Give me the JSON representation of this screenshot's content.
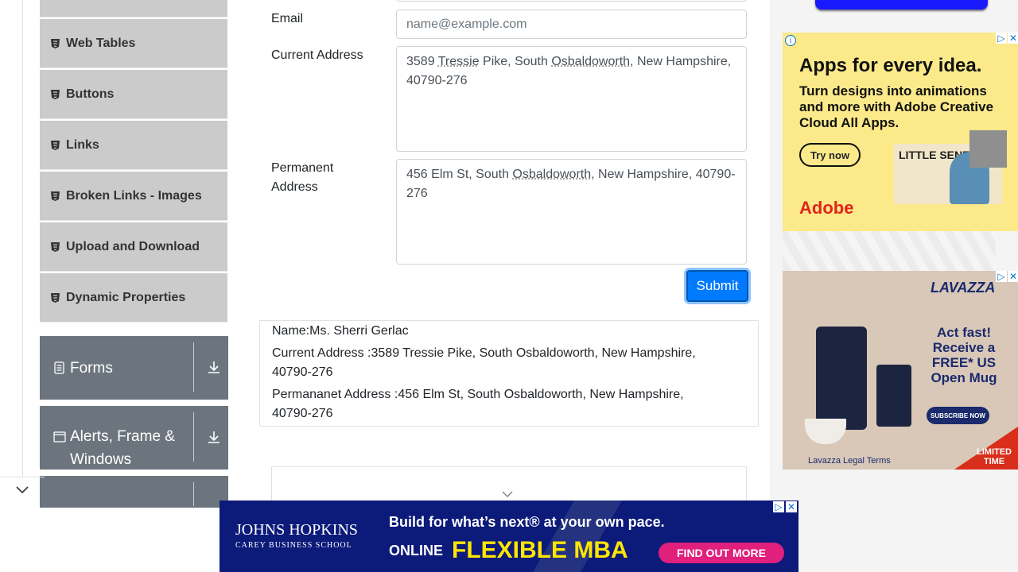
{
  "sidebar": {
    "elements": [
      {
        "label": "Web Tables"
      },
      {
        "label": "Buttons"
      },
      {
        "label": "Links"
      },
      {
        "label": "Broken Links - Images"
      },
      {
        "label": "Upload and Download"
      },
      {
        "label": "Dynamic Properties"
      }
    ],
    "groups": [
      {
        "label": "Forms"
      },
      {
        "label": "Alerts, Frame & Windows"
      }
    ]
  },
  "form": {
    "email_label": "Email",
    "email_placeholder": "name@example.com",
    "current_address_label": "Current Address",
    "current_address_value": {
      "p1": "3589 ",
      "w1": "Tressie",
      "p2": " Pike, South ",
      "w2": "Osbaldoworth",
      "p3": ", New Hampshire, 40790-276"
    },
    "permanent_address_label": "Permanent Address",
    "permanent_address_value": {
      "p1": "456 Elm St, South ",
      "w1": "Osbaldoworth",
      "p2": ", New Hampshire, 40790-276"
    },
    "submit_label": "Submit"
  },
  "output": {
    "name": "Name:Ms. Sherri Gerlac",
    "current_address": "Current Address :3589 Tressie Pike, South Osbaldoworth, New Hampshire, 40790-276",
    "permanent_address": "Permananet Address :456 Elm St, South Osbaldoworth, New Hampshire, 40790-276"
  },
  "ads": {
    "adobe": {
      "headline": "Apps for every idea.",
      "body": "Turn designs into animations and more with Adobe Creative Cloud All Apps.",
      "cta": "Try now",
      "art_text": "LITTLE SENEGAL",
      "logo": "Adobe"
    },
    "lavazza": {
      "brand": "LAVAZZA",
      "headline": "Act fast! Receive a FREE* US Open Mug",
      "cta": "SUBSCRIBE NOW",
      "legal": "Lavazza Legal Terms",
      "limited": "LIMITED TIME"
    },
    "jhu": {
      "school": "JOHNS HOPKINS",
      "school_sub": "CAREY BUSINESS SCHOOL",
      "tagline": "Build for what’s next® at your own pace.",
      "online": "ONLINE",
      "program": "FLEXIBLE MBA",
      "cta": "FIND OUT MORE"
    }
  },
  "colors": {
    "sidebar_item_bg": "#cbcbcb",
    "group_bg": "#6c757d",
    "primary": "#007bff",
    "banner_bg": "#0c1a7a"
  }
}
